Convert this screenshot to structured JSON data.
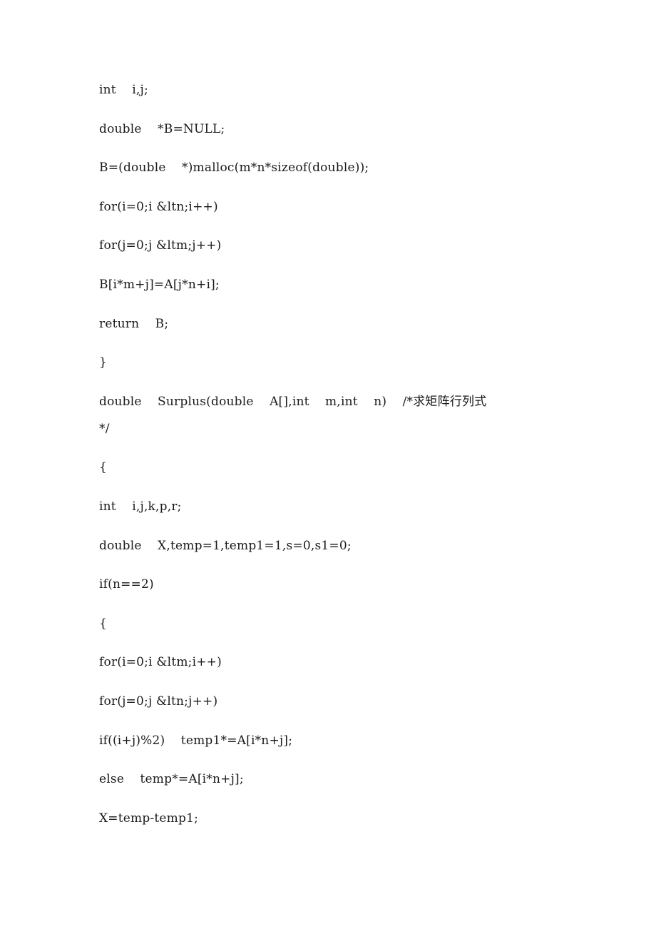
{
  "document": {
    "lines": [
      "int    i,j;",
      "double    *B=NULL;",
      "B=(double    *)malloc(m*n*sizeof(double));",
      "for(i=0;i &ltn;i++)",
      "for(j=0;j &ltm;j++)",
      "B[i*m+j]=A[j*n+i];",
      "return    B;",
      "}",
      "double    Surplus(double    A[],int    m,int    n)    /*求矩阵行列式",
      "*/",
      "{",
      "int    i,j,k,p,r;",
      "double    X,temp=1,temp1=1,s=0,s1=0;",
      "if(n==2)",
      "{",
      "for(i=0;i &ltm;i++)",
      "for(j=0;j &ltn;j++)",
      "if((i+j)%2)    temp1*=A[i*n+j];",
      "else    temp*=A[i*n+j];",
      "X=temp-temp1;"
    ]
  }
}
